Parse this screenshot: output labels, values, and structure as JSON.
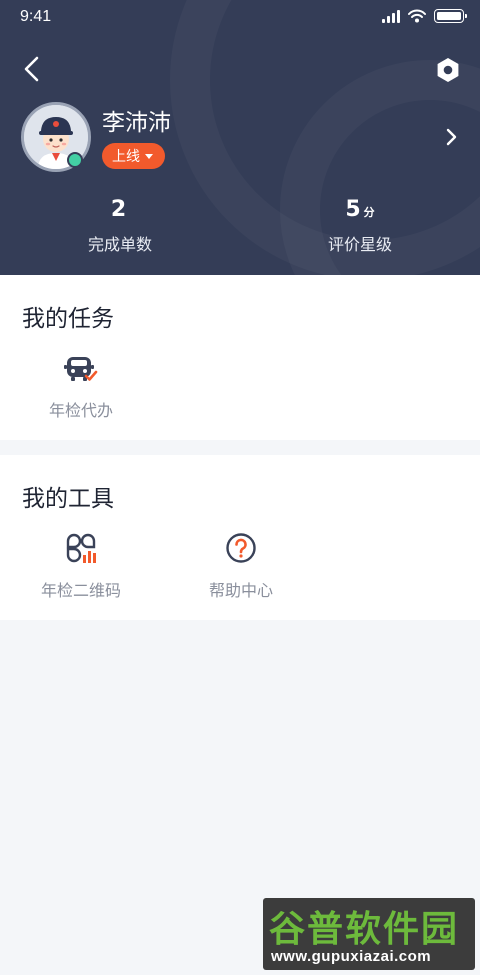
{
  "status_bar": {
    "time": "9:41"
  },
  "profile": {
    "name": "李沛沛",
    "status": "上线",
    "stats": [
      {
        "value": "2",
        "unit": "",
        "label": "完成单数"
      },
      {
        "value": "5",
        "unit": "分",
        "label": "评价星级"
      }
    ]
  },
  "tasks": {
    "title": "我的任务",
    "items": [
      {
        "label": "年检代办",
        "icon": "car-check-icon"
      }
    ]
  },
  "tools": {
    "title": "我的工具",
    "items": [
      {
        "label": "年检二维码",
        "icon": "qrcode-icon"
      },
      {
        "label": "帮助中心",
        "icon": "help-icon"
      }
    ]
  },
  "watermark": {
    "title": "谷普软件园",
    "url": "www.gupuxiazai.com"
  },
  "colors": {
    "header": "#343d57",
    "accent": "#f25a2c",
    "online": "#43d0a4",
    "page_bg": "#f4f6f9"
  }
}
